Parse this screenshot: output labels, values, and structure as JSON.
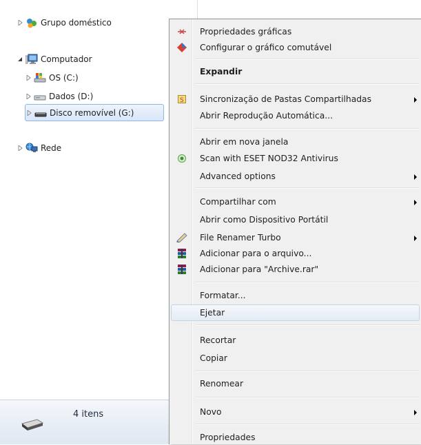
{
  "nav": {
    "homegroup": "Grupo doméstico",
    "computer": "Computador",
    "drive_c": "OS (C:)",
    "drive_d": "Dados (D:)",
    "drive_g": "Disco removível (G:)",
    "network": "Rede"
  },
  "status": {
    "item_count": "4 itens"
  },
  "menu": {
    "items": [
      {
        "label": "Propriedades gráficas",
        "icon": "graphics-properties-icon"
      },
      {
        "label": "Configurar o gráfico comutável",
        "icon": "switchable-graphics-icon"
      },
      {
        "label": "Expandir"
      },
      {
        "label": "Sincronização de Pastas Compartilhadas",
        "icon": "sync-icon",
        "submenu": true
      },
      {
        "label": "Abrir Reprodução Automática..."
      },
      {
        "label": "Abrir em nova janela"
      },
      {
        "label": "Scan with ESET NOD32 Antivirus",
        "icon": "eset-icon"
      },
      {
        "label": "Advanced options",
        "submenu": true
      },
      {
        "label": "Compartilhar com",
        "submenu": true
      },
      {
        "label": "Abrir como Dispositivo Portátil"
      },
      {
        "label": "File Renamer Turbo",
        "icon": "file-renamer-icon",
        "submenu": true
      },
      {
        "label": "Adicionar para o arquivo...",
        "icon": "winrar-icon"
      },
      {
        "label": "Adicionar para \"Archive.rar\"",
        "icon": "winrar-icon"
      },
      {
        "label": "Formatar..."
      },
      {
        "label": "Ejetar"
      },
      {
        "label": "Recortar"
      },
      {
        "label": "Copiar"
      },
      {
        "label": "Renomear"
      },
      {
        "label": "Novo",
        "submenu": true
      },
      {
        "label": "Propriedades"
      }
    ]
  },
  "colors": {
    "selection_border": "#8fb4e6",
    "menu_background": "#f0f0f0",
    "hover_border": "#c3d3e8"
  }
}
